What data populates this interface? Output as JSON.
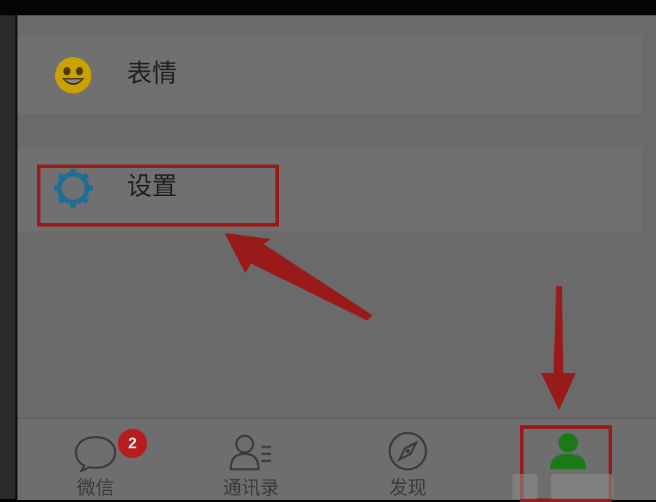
{
  "menu": {
    "emoji_label": "表情",
    "settings_label": "设置"
  },
  "tabs": [
    {
      "label": "微信",
      "icon": "chat-bubble-icon",
      "badge": "2"
    },
    {
      "label": "通讯录",
      "icon": "contacts-icon"
    },
    {
      "label": "发现",
      "icon": "compass-icon"
    },
    {
      "label": "",
      "icon": "person-icon",
      "active": true
    }
  ],
  "colors": {
    "emoji_yellow": "#c9a100",
    "gear_blue": "#1f6f95",
    "active_green": "#1a7a1a",
    "annotation_red": "#9a1a1a"
  }
}
